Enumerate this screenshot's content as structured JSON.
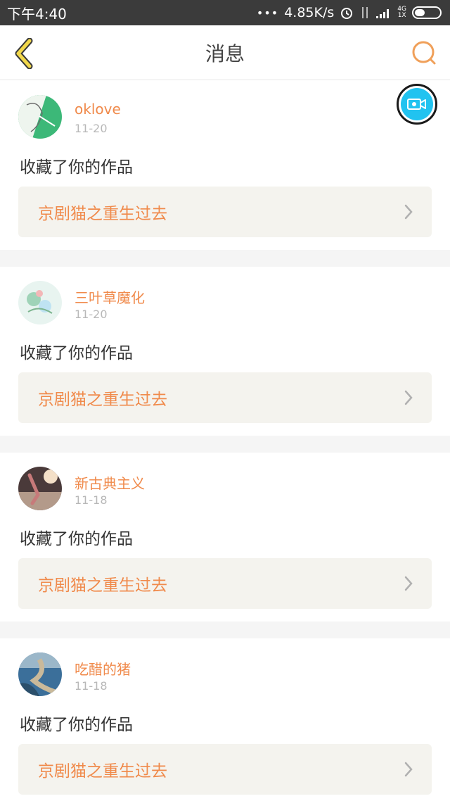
{
  "status_bar": {
    "time": "下午4:40",
    "dots": "•••",
    "speed": "4.85K/s",
    "net_top": "4G",
    "net_bottom": "1X"
  },
  "nav": {
    "title": "消息",
    "back_icon": "chevron-left-icon",
    "search_icon": "search-icon",
    "accent_color": "#f0a43a"
  },
  "camera": {
    "icon": "video-camera-icon",
    "color": "#21c3f0"
  },
  "messages": [
    {
      "username": "oklove",
      "date": "11-20",
      "action": "收藏了你的作品",
      "work_title": "京剧猫之重生过去"
    },
    {
      "username": "三叶草魔化",
      "date": "11-20",
      "action": "收藏了你的作品",
      "work_title": "京剧猫之重生过去"
    },
    {
      "username": "新古典主义",
      "date": "11-18",
      "action": "收藏了你的作品",
      "work_title": "京剧猫之重生过去"
    },
    {
      "username": "吃醋的猪",
      "date": "11-18",
      "action": "收藏了你的作品",
      "work_title": "京剧猫之重生过去"
    }
  ],
  "colors": {
    "username": "#f08a4b",
    "date": "#b8b8b8",
    "work_bg": "#f4f3ee"
  }
}
